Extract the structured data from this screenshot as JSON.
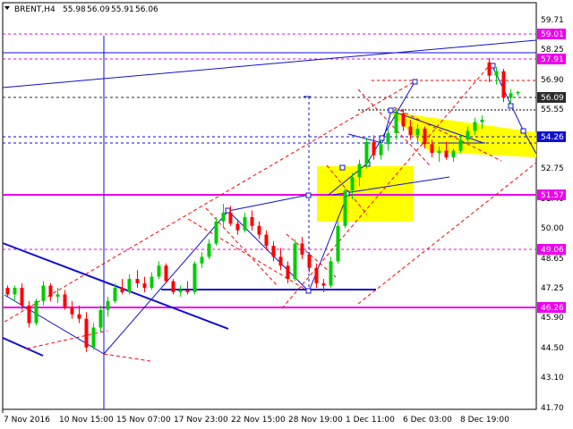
{
  "header": {
    "symbol": "BRENT,H4",
    "open": "55.98",
    "high": "56.09",
    "low": "55.91",
    "close": "56.06"
  },
  "price_axis": [
    "59.71",
    "58.25",
    "56.90",
    "55.55",
    "54.20",
    "52.75",
    "51.40",
    "50.00",
    "48.65",
    "47.25",
    "45.90",
    "44.50",
    "43.10",
    "41.70"
  ],
  "price_labels": [
    {
      "text": "59.01",
      "color": "#ee00ee"
    },
    {
      "text": "57.91",
      "color": "#ee00ee"
    },
    {
      "text": "56.09",
      "color": "#2b2b2b"
    },
    {
      "text": "54.26",
      "color": "#1010d0"
    },
    {
      "text": "51.57",
      "color": "#ee00ee"
    },
    {
      "text": "49.06",
      "color": "#ee00ee"
    },
    {
      "text": "46.26",
      "color": "#ee00ee"
    }
  ],
  "time_axis": [
    "7 Nov 2016",
    "10 Nov 15:00",
    "15 Nov 07:00",
    "17 Nov 23:00",
    "22 Nov 15:00",
    "28 Nov 19:00",
    "1 Dec 11:00",
    "6 Dec 03:00",
    "8 Dec 19:00"
  ],
  "colors": {
    "bull": "#00cc00",
    "bear": "#ff0000",
    "level": "#ee00ee",
    "channel": "#ff0000",
    "trend": "#1010d0",
    "zone": "#ffff00",
    "bg": "#ffffff"
  },
  "chart_data": {
    "type": "candlestick",
    "instrument": "BRENT",
    "timeframe": "H4",
    "ylim": [
      41.7,
      60.1
    ],
    "horizontal_levels": [
      59.01,
      57.91,
      54.26,
      51.57,
      49.06,
      46.26
    ],
    "current_price": 56.09,
    "candles": [
      [
        47.2,
        47.3,
        46.8,
        46.9
      ],
      [
        46.9,
        47.3,
        46.6,
        47.2
      ],
      [
        47.2,
        47.4,
        46.2,
        46.4
      ],
      [
        46.4,
        46.6,
        45.4,
        45.6
      ],
      [
        45.6,
        46.7,
        45.5,
        46.6
      ],
      [
        46.6,
        47.5,
        46.4,
        47.3
      ],
      [
        47.3,
        47.4,
        46.6,
        46.8
      ],
      [
        46.8,
        47.2,
        46.5,
        46.9
      ],
      [
        46.9,
        47.1,
        46.2,
        46.3
      ],
      [
        46.3,
        46.6,
        45.8,
        46.0
      ],
      [
        46.0,
        46.4,
        45.6,
        45.8
      ],
      [
        45.8,
        46.1,
        44.3,
        44.5
      ],
      [
        44.5,
        45.6,
        44.4,
        45.4
      ],
      [
        45.4,
        46.4,
        45.2,
        46.2
      ],
      [
        46.2,
        46.8,
        45.9,
        46.6
      ],
      [
        46.6,
        47.4,
        46.5,
        47.2
      ],
      [
        47.2,
        47.6,
        46.9,
        47.0
      ],
      [
        47.0,
        47.8,
        46.9,
        47.6
      ],
      [
        47.6,
        48.0,
        47.2,
        47.4
      ],
      [
        47.4,
        47.7,
        47.0,
        47.2
      ],
      [
        47.2,
        47.9,
        47.1,
        47.7
      ],
      [
        47.7,
        48.4,
        47.6,
        48.2
      ],
      [
        48.2,
        48.3,
        47.4,
        47.5
      ],
      [
        47.5,
        47.6,
        46.9,
        47.0
      ],
      [
        47.0,
        47.3,
        46.8,
        47.1
      ],
      [
        47.1,
        47.5,
        46.9,
        47.0
      ],
      [
        47.0,
        48.4,
        46.9,
        48.3
      ],
      [
        48.3,
        48.8,
        48.1,
        48.6
      ],
      [
        48.6,
        49.4,
        48.5,
        49.2
      ],
      [
        49.2,
        50.4,
        49.1,
        50.2
      ],
      [
        50.2,
        51.0,
        49.9,
        50.6
      ],
      [
        50.6,
        50.9,
        50.0,
        50.1
      ],
      [
        50.1,
        50.3,
        49.6,
        49.8
      ],
      [
        49.8,
        50.6,
        49.7,
        50.4
      ],
      [
        50.4,
        50.7,
        49.8,
        50.0
      ],
      [
        50.0,
        50.2,
        49.4,
        49.6
      ],
      [
        49.6,
        49.8,
        48.9,
        49.1
      ],
      [
        49.1,
        49.3,
        48.4,
        48.6
      ],
      [
        48.6,
        49.0,
        48.0,
        48.2
      ],
      [
        48.2,
        48.4,
        47.4,
        47.6
      ],
      [
        47.6,
        49.4,
        47.5,
        49.2
      ],
      [
        49.2,
        49.5,
        48.5,
        48.7
      ],
      [
        48.7,
        48.8,
        47.9,
        48.1
      ],
      [
        48.1,
        48.3,
        47.2,
        47.4
      ],
      [
        47.4,
        47.6,
        47.0,
        47.3
      ],
      [
        47.3,
        48.6,
        47.2,
        48.4
      ],
      [
        48.4,
        50.2,
        48.3,
        50.0
      ],
      [
        50.0,
        51.7,
        49.9,
        51.6
      ],
      [
        51.6,
        52.4,
        51.2,
        52.2
      ],
      [
        52.2,
        53.0,
        51.8,
        52.8
      ],
      [
        52.8,
        54.0,
        52.6,
        53.8
      ],
      [
        53.8,
        54.1,
        53.0,
        53.2
      ],
      [
        53.2,
        53.9,
        53.0,
        53.7
      ],
      [
        53.7,
        54.4,
        53.4,
        54.2
      ],
      [
        54.2,
        55.3,
        53.9,
        55.1
      ],
      [
        55.1,
        55.3,
        54.3,
        54.5
      ],
      [
        54.5,
        54.8,
        53.9,
        54.1
      ],
      [
        54.1,
        54.6,
        53.8,
        54.4
      ],
      [
        54.4,
        54.5,
        53.5,
        53.7
      ],
      [
        53.7,
        53.9,
        53.1,
        53.3
      ],
      [
        53.3,
        53.6,
        52.9,
        53.4
      ],
      [
        53.4,
        53.8,
        53.0,
        53.1
      ],
      [
        53.1,
        53.5,
        52.9,
        53.4
      ],
      [
        53.4,
        54.1,
        53.3,
        53.9
      ],
      [
        53.9,
        54.5,
        53.7,
        54.3
      ],
      [
        54.3,
        54.9,
        54.1,
        54.7
      ],
      [
        54.7,
        55.0,
        54.4,
        54.8
      ],
      [
        57.4,
        57.6,
        56.5,
        56.8
      ],
      [
        56.8,
        57.2,
        56.4,
        57.0
      ],
      [
        57.0,
        57.1,
        55.6,
        55.8
      ],
      [
        55.8,
        56.2,
        55.5,
        56.0
      ],
      [
        56.0,
        56.1,
        55.9,
        56.06
      ]
    ]
  }
}
